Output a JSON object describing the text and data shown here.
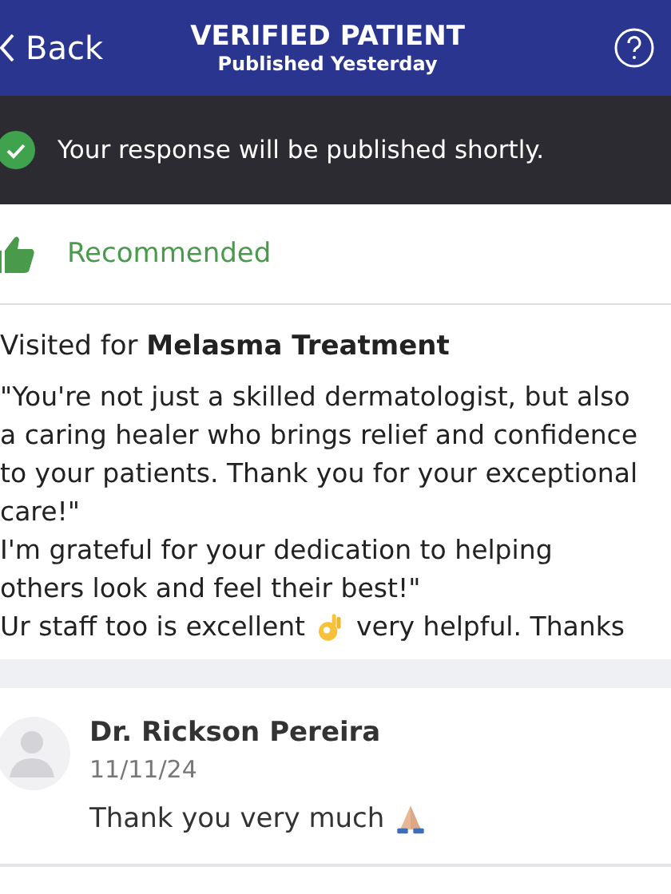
{
  "header": {
    "back_label": "Back",
    "title": "VERIFIED PATIENT",
    "subtitle": "Published Yesterday"
  },
  "banner": {
    "message": "Your response will be published shortly."
  },
  "recommendation": {
    "label": "Recommended",
    "recommended": true
  },
  "review": {
    "visited": "Visited for **Melasma Treatment**",
    "lines": [
      {
        "text": "\"You're not just a skilled dermatologist, but also"
      },
      {
        "text": "a caring healer who brings relief and confidence"
      },
      {
        "text": "to your patients. Thank you for your exceptional"
      },
      {
        "text": "care!\""
      },
      {
        "text": "I'm grateful for your dedication to helping"
      },
      {
        "text": "others look and feel their best!\""
      },
      {
        "parts": [
          {
            "kind": "text",
            "text": "Ur staff too is excellent"
          },
          {
            "kind": "okhand"
          },
          {
            "kind": "text",
            "text": "very helpful. Thanks"
          }
        ]
      }
    ]
  },
  "reply": {
    "author": "Dr. Rickson Pereira",
    "date": "11/11/24",
    "parts": [
      {
        "kind": "text",
        "text": "Thank you very much"
      },
      {
        "kind": "praying"
      }
    ]
  }
}
